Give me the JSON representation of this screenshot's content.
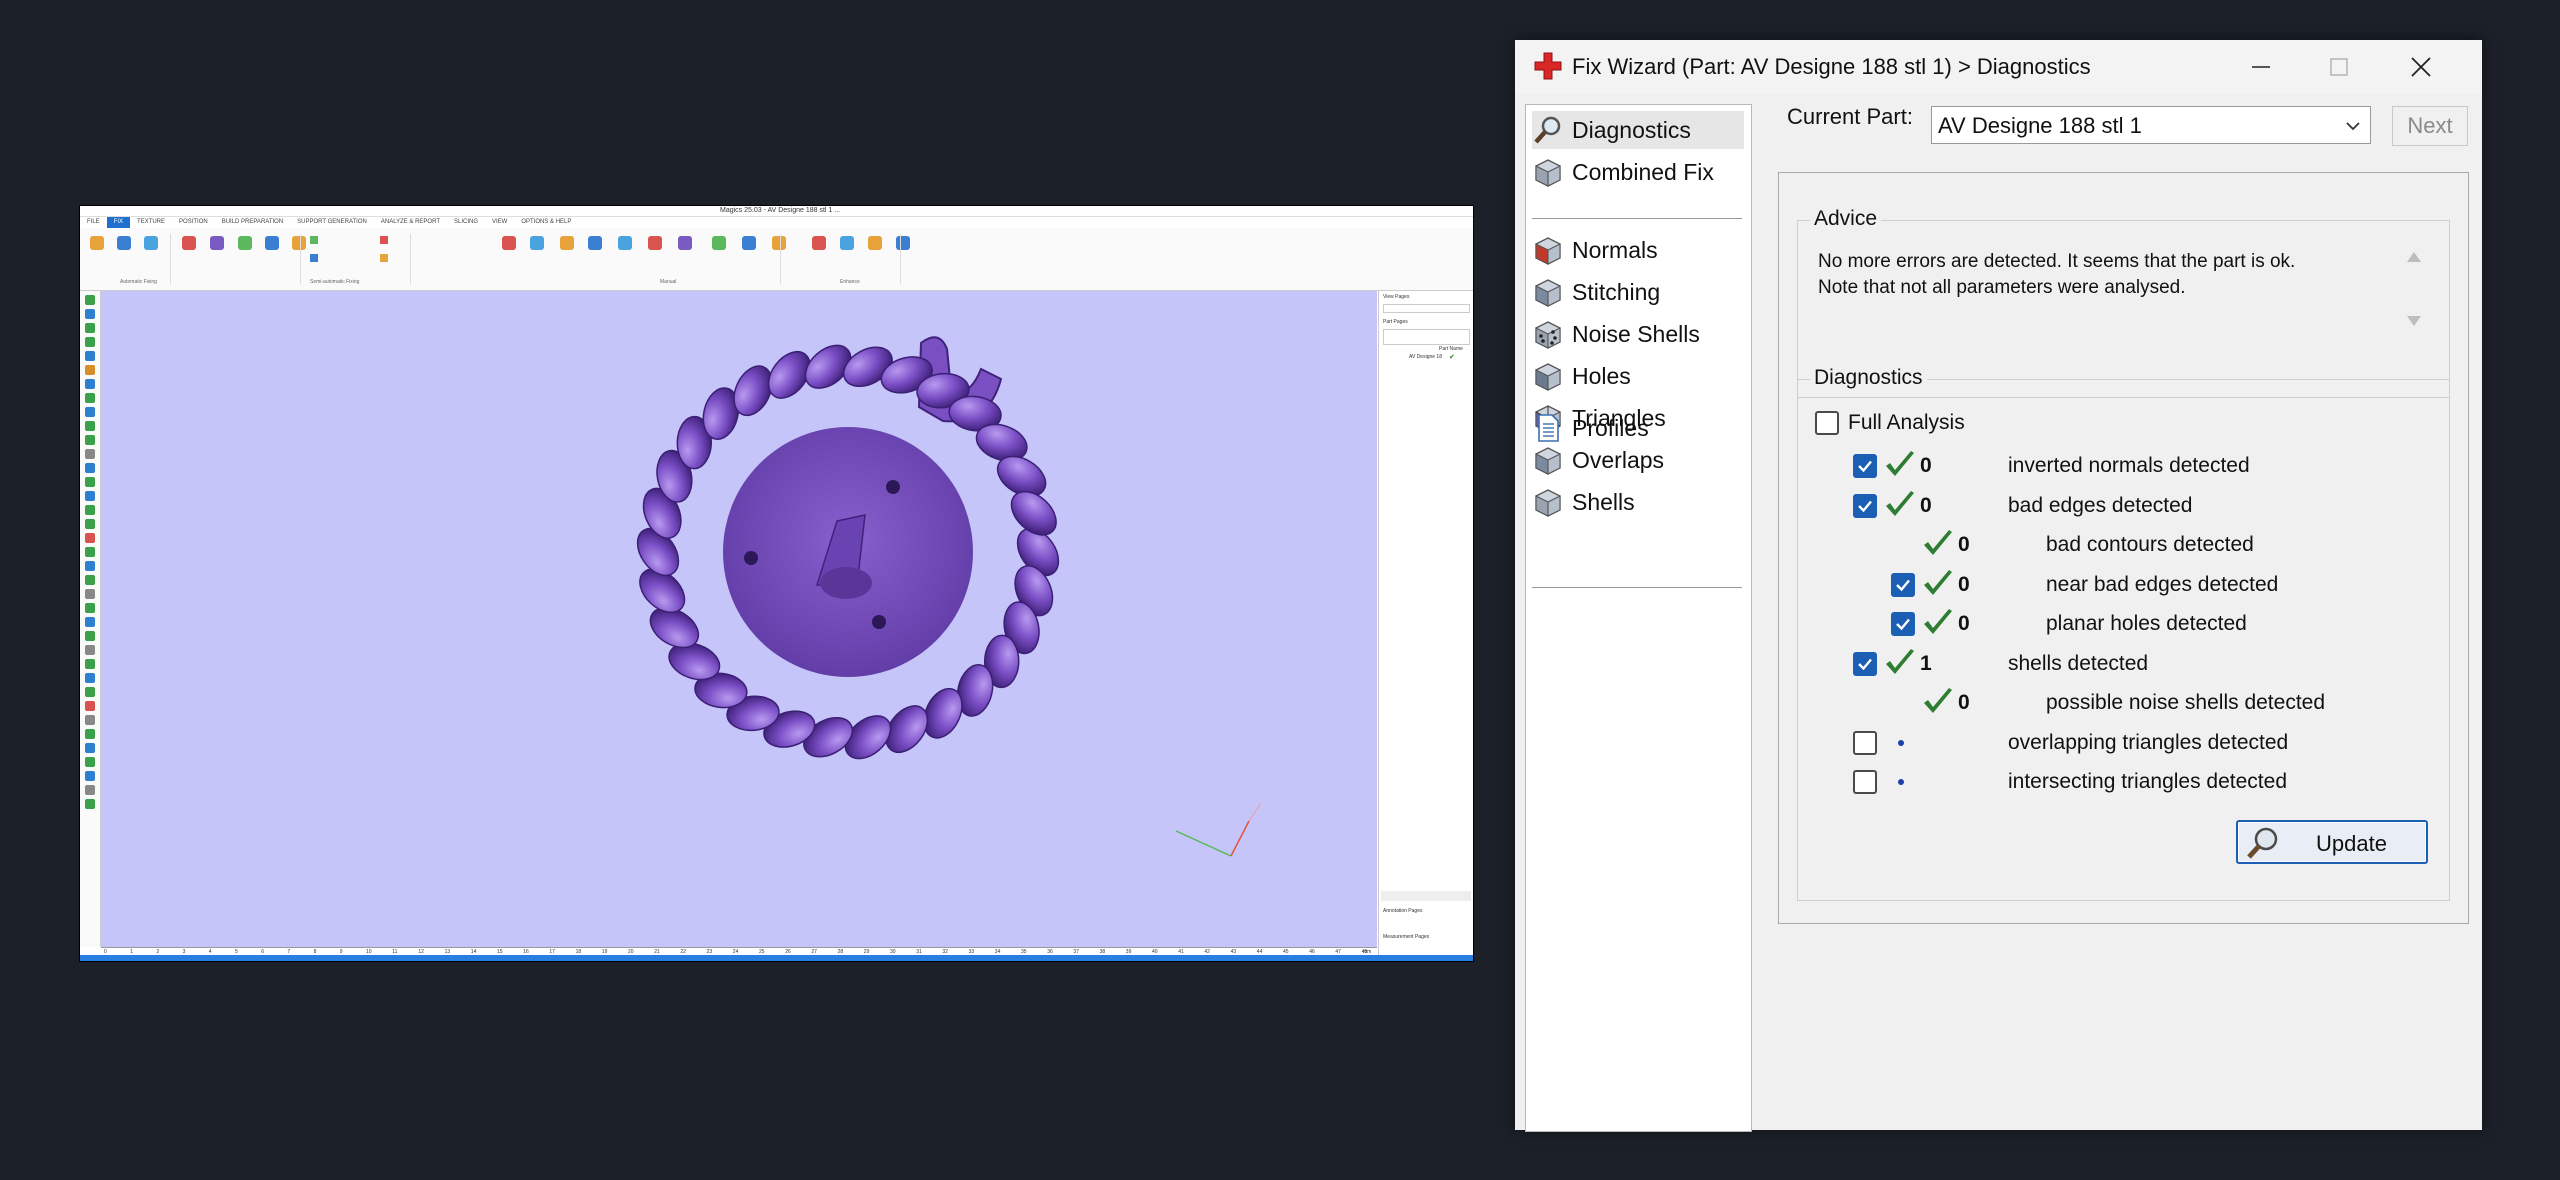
{
  "magics": {
    "title": "Magics 25.03 - AV Designe 188 stl 1 ...",
    "menus": [
      "FILE",
      "FIX",
      "TEXTURE",
      "POSITION",
      "BUILD PREPARATION",
      "SUPPORT GENERATION",
      "ANALYZE & REPORT",
      "SLICING",
      "VIEW",
      "OPTIONS & HELP"
    ],
    "ribbon_groups": [
      "Automatic Fixing",
      "Semi-automatic Fixing",
      "Manual",
      "Enhance"
    ],
    "ruler_ticks": [
      "0",
      "1",
      "2",
      "3",
      "4",
      "5",
      "6",
      "7",
      "8",
      "9",
      "10",
      "11",
      "12",
      "13",
      "14",
      "15",
      "16",
      "17",
      "18",
      "19",
      "20",
      "21",
      "22",
      "23",
      "24",
      "25",
      "26",
      "27",
      "28",
      "29",
      "30",
      "31",
      "32",
      "33",
      "34",
      "35",
      "36",
      "37",
      "38",
      "39",
      "40",
      "41",
      "42",
      "43",
      "44",
      "45",
      "46",
      "47",
      "48"
    ],
    "ruler_unit": "mm",
    "right_panel": {
      "view_pages": "View Pages",
      "part_pages": "Part Pages",
      "part_name_header": "Part Name",
      "part_name": "AV Designe 18",
      "annotation_pages": "Annotation Pages",
      "measurement_pages": "Measurement Pages"
    }
  },
  "dialog": {
    "title": "Fix Wizard (Part: AV Designe 188 stl 1) > Diagnostics",
    "sidebar": {
      "group1": [
        {
          "label": "Diagnostics",
          "icon": "magnifier-icon",
          "selected": true
        },
        {
          "label": "Combined Fix",
          "icon": "cubes-icon",
          "selected": false
        }
      ],
      "group2": [
        {
          "label": "Normals",
          "icon": "normals-cube-icon"
        },
        {
          "label": "Stitching",
          "icon": "stitching-cube-icon"
        },
        {
          "label": "Noise Shells",
          "icon": "noise-shells-icon"
        },
        {
          "label": "Holes",
          "icon": "holes-cube-icon"
        },
        {
          "label": "Triangles",
          "icon": "triangles-icon"
        },
        {
          "label": "Overlaps",
          "icon": "overlaps-cube-icon"
        },
        {
          "label": "Shells",
          "icon": "shells-icon"
        }
      ],
      "group3": [
        {
          "label": "Profiles",
          "icon": "profiles-doc-icon"
        }
      ]
    },
    "current_part_label": "Current Part:",
    "current_part_value": "AV Designe 188 stl 1",
    "next_label": "Next",
    "advice_title": "Advice",
    "advice_text": "No more errors are detected. It seems that the part is ok.\nNote that not all parameters were analysed.",
    "diagnostics_title": "Diagnostics",
    "full_analysis_label": "Full Analysis",
    "full_analysis_checked": false,
    "rows": [
      {
        "checkbox": "on",
        "status": "ok",
        "count": "0",
        "label": "inverted normals detected",
        "indent": 0
      },
      {
        "checkbox": "on",
        "status": "ok",
        "count": "0",
        "label": "bad edges detected",
        "indent": 0
      },
      {
        "checkbox": "none",
        "status": "ok",
        "count": "0",
        "label": "bad contours detected",
        "indent": 1
      },
      {
        "checkbox": "on",
        "status": "ok",
        "count": "0",
        "label": "near bad edges detected",
        "indent": 1
      },
      {
        "checkbox": "on",
        "status": "ok",
        "count": "0",
        "label": "planar holes detected",
        "indent": 1
      },
      {
        "checkbox": "on",
        "status": "ok",
        "count": "1",
        "label": "shells detected",
        "indent": 0
      },
      {
        "checkbox": "none",
        "status": "ok",
        "count": "0",
        "label": "possible noise shells detected",
        "indent": 1
      },
      {
        "checkbox": "off",
        "status": "dot",
        "count": "",
        "label": "overlapping triangles detected",
        "indent": 0
      },
      {
        "checkbox": "off",
        "status": "dot",
        "count": "",
        "label": "intersecting triangles detected",
        "indent": 0
      }
    ],
    "update_label": "Update",
    "colors": {
      "accent": "#1a5fb4",
      "tick": "#2e7d32",
      "model": "#7e54c4",
      "viewport": "#c6c5f9"
    }
  }
}
